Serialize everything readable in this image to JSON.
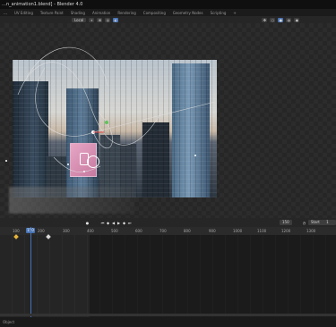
{
  "window": {
    "title": "…n_animation1.blend] - Blender 4.0"
  },
  "tabs": [
    "…",
    "UV Editing",
    "Texture Paint",
    "Shading",
    "Animation",
    "Rendering",
    "Compositing",
    "Geometry Nodes",
    "Scripting",
    "+"
  ],
  "active_tab_index": 0,
  "viewport_header": {
    "orientation": "Local"
  },
  "timeline": {
    "current_frame": "150",
    "end_frame": "150",
    "start_label": "Start",
    "start_value": "1"
  },
  "ruler_ticks": [
    "100",
    "150",
    "200",
    "300",
    "400",
    "500",
    "600",
    "700",
    "800",
    "900",
    "1000",
    "1100",
    "1200",
    "1300"
  ],
  "status": {
    "text": "Object"
  },
  "colors": {
    "accent": "#4772b3",
    "keyframe": "#e6b43b"
  }
}
